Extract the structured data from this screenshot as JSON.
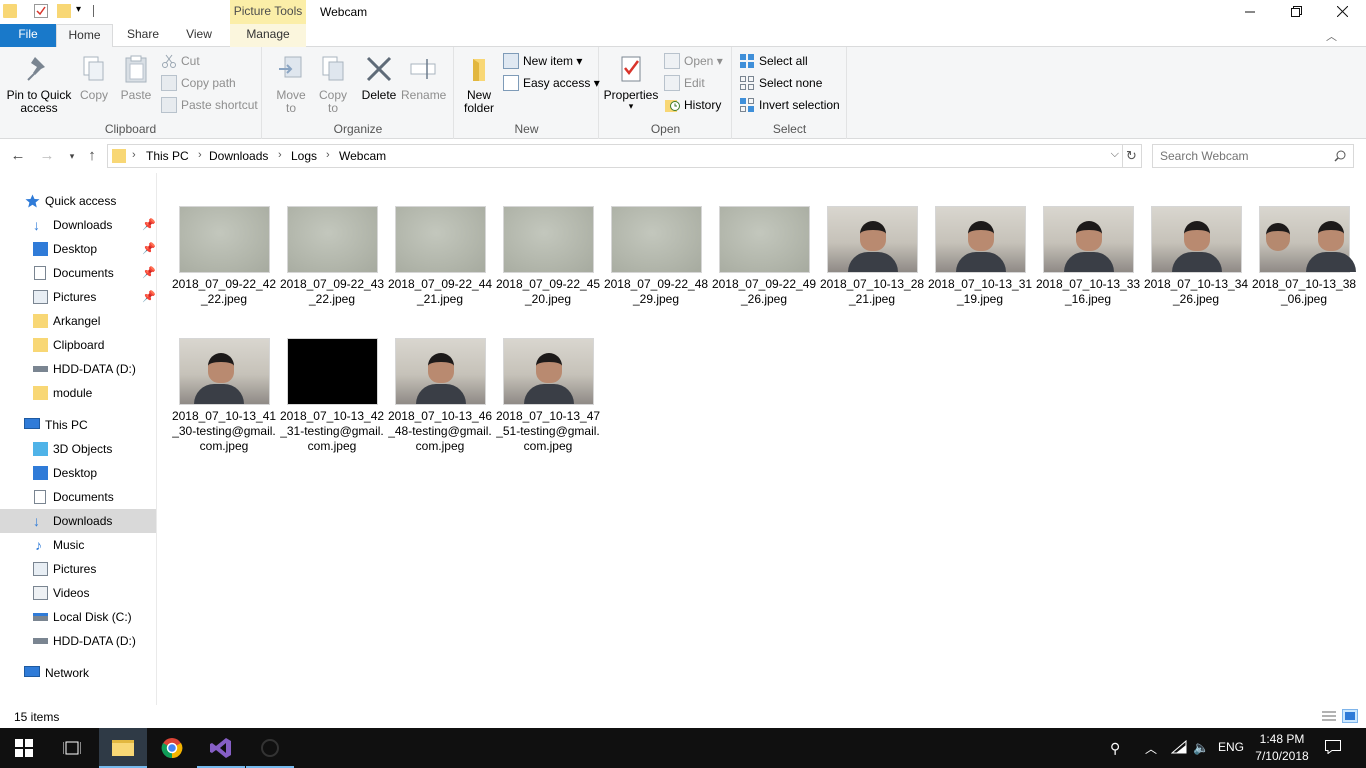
{
  "window": {
    "title": "Webcam",
    "context_tab": "Picture Tools"
  },
  "tabs": {
    "file": "File",
    "home": "Home",
    "share": "Share",
    "view": "View",
    "manage": "Manage"
  },
  "ribbon": {
    "clipboard": {
      "label": "Clipboard",
      "pin": "Pin to Quick access",
      "copy": "Copy",
      "paste": "Paste",
      "cut": "Cut",
      "copy_path": "Copy path",
      "paste_shortcut": "Paste shortcut"
    },
    "organize": {
      "label": "Organize",
      "move_to": "Move to",
      "copy_to": "Copy to",
      "delete": "Delete",
      "rename": "Rename"
    },
    "new": {
      "label": "New",
      "new_folder": "New folder",
      "new_item": "New item",
      "easy_access": "Easy access"
    },
    "open": {
      "label": "Open",
      "properties": "Properties",
      "open": "Open",
      "edit": "Edit",
      "history": "History"
    },
    "select": {
      "label": "Select",
      "select_all": "Select all",
      "select_none": "Select none",
      "invert": "Invert selection"
    }
  },
  "address": {
    "crumbs": [
      "This PC",
      "Downloads",
      "Logs",
      "Webcam"
    ]
  },
  "search": {
    "placeholder": "Search Webcam"
  },
  "nav": {
    "quick_access": "Quick access",
    "qa_items": [
      "Downloads",
      "Desktop",
      "Documents",
      "Pictures",
      "Arkangel",
      "Clipboard",
      "HDD-DATA (D:)",
      "module"
    ],
    "this_pc": "This PC",
    "pc_items": [
      "3D Objects",
      "Desktop",
      "Documents",
      "Downloads",
      "Music",
      "Pictures",
      "Videos",
      "Local Disk (C:)",
      "HDD-DATA (D:)"
    ],
    "network": "Network",
    "selected": "Downloads"
  },
  "files": [
    {
      "name": "2018_07_09-22_42_22.jpeg",
      "kind": "blank"
    },
    {
      "name": "2018_07_09-22_43_22.jpeg",
      "kind": "blank"
    },
    {
      "name": "2018_07_09-22_44_21.jpeg",
      "kind": "blank"
    },
    {
      "name": "2018_07_09-22_45_20.jpeg",
      "kind": "blank"
    },
    {
      "name": "2018_07_09-22_48_29.jpeg",
      "kind": "blank"
    },
    {
      "name": "2018_07_09-22_49_26.jpeg",
      "kind": "blank"
    },
    {
      "name": "2018_07_10-13_28_21.jpeg",
      "kind": "face"
    },
    {
      "name": "2018_07_10-13_31_19.jpeg",
      "kind": "face"
    },
    {
      "name": "2018_07_10-13_33_16.jpeg",
      "kind": "face"
    },
    {
      "name": "2018_07_10-13_34_26.jpeg",
      "kind": "face"
    },
    {
      "name": "2018_07_10-13_38_06.jpeg",
      "kind": "face2"
    },
    {
      "name": "2018_07_10-13_41_30-testing@gmail.com.jpeg",
      "kind": "face3"
    },
    {
      "name": "2018_07_10-13_42_31-testing@gmail.com.jpeg",
      "kind": "black"
    },
    {
      "name": "2018_07_10-13_46_48-testing@gmail.com.jpeg",
      "kind": "face"
    },
    {
      "name": "2018_07_10-13_47_51-testing@gmail.com.jpeg",
      "kind": "face"
    }
  ],
  "status": {
    "item_count": "15 items"
  },
  "taskbar": {
    "lang": "ENG",
    "time": "1:48 PM",
    "date": "7/10/2018"
  },
  "colors": {
    "accent": "#1979ca",
    "context_tab": "#fbeea8",
    "folder": "#f8d775"
  }
}
